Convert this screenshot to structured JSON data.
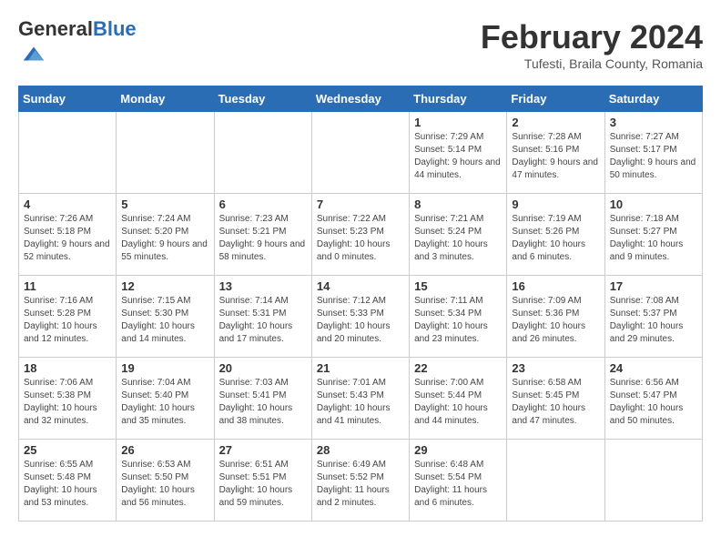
{
  "header": {
    "logo_general": "General",
    "logo_blue": "Blue",
    "month_title": "February 2024",
    "subtitle": "Tufesti, Braila County, Romania"
  },
  "weekdays": [
    "Sunday",
    "Monday",
    "Tuesday",
    "Wednesday",
    "Thursday",
    "Friday",
    "Saturday"
  ],
  "weeks": [
    [
      {
        "day": "",
        "empty": true
      },
      {
        "day": "",
        "empty": true
      },
      {
        "day": "",
        "empty": true
      },
      {
        "day": "",
        "empty": true
      },
      {
        "day": "1",
        "sunrise": "7:29 AM",
        "sunset": "5:14 PM",
        "daylight": "9 hours and 44 minutes."
      },
      {
        "day": "2",
        "sunrise": "7:28 AM",
        "sunset": "5:16 PM",
        "daylight": "9 hours and 47 minutes."
      },
      {
        "day": "3",
        "sunrise": "7:27 AM",
        "sunset": "5:17 PM",
        "daylight": "9 hours and 50 minutes."
      }
    ],
    [
      {
        "day": "4",
        "sunrise": "7:26 AM",
        "sunset": "5:18 PM",
        "daylight": "9 hours and 52 minutes."
      },
      {
        "day": "5",
        "sunrise": "7:24 AM",
        "sunset": "5:20 PM",
        "daylight": "9 hours and 55 minutes."
      },
      {
        "day": "6",
        "sunrise": "7:23 AM",
        "sunset": "5:21 PM",
        "daylight": "9 hours and 58 minutes."
      },
      {
        "day": "7",
        "sunrise": "7:22 AM",
        "sunset": "5:23 PM",
        "daylight": "10 hours and 0 minutes."
      },
      {
        "day": "8",
        "sunrise": "7:21 AM",
        "sunset": "5:24 PM",
        "daylight": "10 hours and 3 minutes."
      },
      {
        "day": "9",
        "sunrise": "7:19 AM",
        "sunset": "5:26 PM",
        "daylight": "10 hours and 6 minutes."
      },
      {
        "day": "10",
        "sunrise": "7:18 AM",
        "sunset": "5:27 PM",
        "daylight": "10 hours and 9 minutes."
      }
    ],
    [
      {
        "day": "11",
        "sunrise": "7:16 AM",
        "sunset": "5:28 PM",
        "daylight": "10 hours and 12 minutes."
      },
      {
        "day": "12",
        "sunrise": "7:15 AM",
        "sunset": "5:30 PM",
        "daylight": "10 hours and 14 minutes."
      },
      {
        "day": "13",
        "sunrise": "7:14 AM",
        "sunset": "5:31 PM",
        "daylight": "10 hours and 17 minutes."
      },
      {
        "day": "14",
        "sunrise": "7:12 AM",
        "sunset": "5:33 PM",
        "daylight": "10 hours and 20 minutes."
      },
      {
        "day": "15",
        "sunrise": "7:11 AM",
        "sunset": "5:34 PM",
        "daylight": "10 hours and 23 minutes."
      },
      {
        "day": "16",
        "sunrise": "7:09 AM",
        "sunset": "5:36 PM",
        "daylight": "10 hours and 26 minutes."
      },
      {
        "day": "17",
        "sunrise": "7:08 AM",
        "sunset": "5:37 PM",
        "daylight": "10 hours and 29 minutes."
      }
    ],
    [
      {
        "day": "18",
        "sunrise": "7:06 AM",
        "sunset": "5:38 PM",
        "daylight": "10 hours and 32 minutes."
      },
      {
        "day": "19",
        "sunrise": "7:04 AM",
        "sunset": "5:40 PM",
        "daylight": "10 hours and 35 minutes."
      },
      {
        "day": "20",
        "sunrise": "7:03 AM",
        "sunset": "5:41 PM",
        "daylight": "10 hours and 38 minutes."
      },
      {
        "day": "21",
        "sunrise": "7:01 AM",
        "sunset": "5:43 PM",
        "daylight": "10 hours and 41 minutes."
      },
      {
        "day": "22",
        "sunrise": "7:00 AM",
        "sunset": "5:44 PM",
        "daylight": "10 hours and 44 minutes."
      },
      {
        "day": "23",
        "sunrise": "6:58 AM",
        "sunset": "5:45 PM",
        "daylight": "10 hours and 47 minutes."
      },
      {
        "day": "24",
        "sunrise": "6:56 AM",
        "sunset": "5:47 PM",
        "daylight": "10 hours and 50 minutes."
      }
    ],
    [
      {
        "day": "25",
        "sunrise": "6:55 AM",
        "sunset": "5:48 PM",
        "daylight": "10 hours and 53 minutes."
      },
      {
        "day": "26",
        "sunrise": "6:53 AM",
        "sunset": "5:50 PM",
        "daylight": "10 hours and 56 minutes."
      },
      {
        "day": "27",
        "sunrise": "6:51 AM",
        "sunset": "5:51 PM",
        "daylight": "10 hours and 59 minutes."
      },
      {
        "day": "28",
        "sunrise": "6:49 AM",
        "sunset": "5:52 PM",
        "daylight": "11 hours and 2 minutes."
      },
      {
        "day": "29",
        "sunrise": "6:48 AM",
        "sunset": "5:54 PM",
        "daylight": "11 hours and 6 minutes."
      },
      {
        "day": "",
        "empty": true
      },
      {
        "day": "",
        "empty": true
      }
    ]
  ],
  "labels": {
    "sunrise": "Sunrise:",
    "sunset": "Sunset:",
    "daylight": "Daylight:"
  }
}
